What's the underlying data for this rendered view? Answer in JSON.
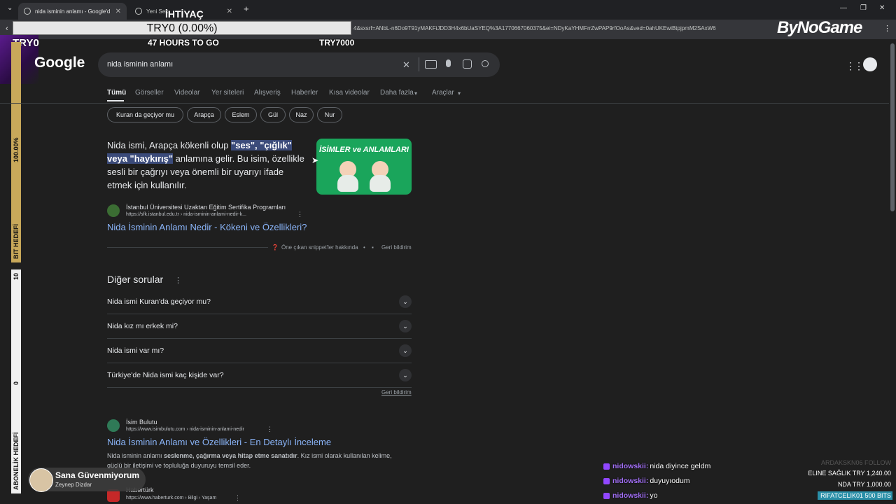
{
  "browser": {
    "tabs": [
      {
        "label": "nida isminin anlamı - Google'd"
      },
      {
        "label": "Yeni Sek"
      }
    ],
    "url": "4&sxsrf=ANbL-n6Do9T91yMAKFiJDD3H4x6bUaSYEQ%3A1770667060375&ei=NDyKaYHMFrrZwPAP9rfOoAs&ved=0ahUKEwiBtpjpmM2SAxW6"
  },
  "overlay": {
    "goal_title": "İHTİYAÇ",
    "goal_value": "TRY0 (0.00%)",
    "left_amount": "TRY0",
    "hours": "47 HOURS TO GO",
    "target": "TRY7000",
    "bar1_pct": "100.00%",
    "bar1_label": "BIT HEDEFİ",
    "bar2_top": "10",
    "bar2_mid": "0",
    "bar2_label": "ABONELİK HEDEFİ",
    "brand": "ByNoGame"
  },
  "google": {
    "logo": "Google",
    "query": "nida isminin anlamı",
    "tabs": [
      "Tümü",
      "Görseller",
      "Videolar",
      "Yer siteleri",
      "Alışveriş",
      "Haberler",
      "Kısa videolar",
      "Daha fazla",
      "Araçlar"
    ],
    "chips": [
      "Kuran da geçiyor mu",
      "Arapça",
      "Eslem",
      "Gül",
      "Naz",
      "Nur"
    ],
    "snippet": {
      "pre": "Nida ismi, Arapça kökenli olup ",
      "highlight": "\"ses\", \"çığlık\" veya \"haykırış\"",
      "post": " anlamına gelir. Bu isim, özellikle sesli bir çağrıyı veya önemli bir uyarıyı ifade etmek için kullanılır.",
      "image_title": "İSİMLER ve ANLAMLARI",
      "source_name": "İstanbul Üniversitesi Uzaktan Eğitim Sertifika Programları",
      "source_url": "https://sfk.istanbul.edu.tr › nida-isminin-anlami-nedir-k...",
      "link": "Nida İsminin Anlamı Nedir - Kökeni ve Özellikleri?",
      "about": "Öne çıkan snippet'ler hakkında",
      "feedback": "Geri bildirim"
    },
    "paa": {
      "title": "Diğer sorular",
      "questions": [
        "Nida ismi Kuran'da geçiyor mu?",
        "Nida kız mı erkek mi?",
        "Nida ismi var mı?",
        "Türkiye'de Nida ismi kaç kişide var?"
      ],
      "feedback": "Geri bildirim"
    },
    "result2": {
      "source_name": "İsim Bulutu",
      "source_url": "https://www.isimbulutu.com › nida-isminin-anlami-nedir",
      "link": "Nida İsminin Anlamı ve Özellikleri - En Detaylı İnceleme",
      "desc_pre": "Nida isminin anlamı ",
      "desc_bold": "seslenme, çağırma veya hitap etme sanatıdır",
      "desc_post": ". Kız ismi olarak kullanılan kelime,",
      "desc_line2": "güçlü bir iletişimi ve topluluğa duyuruyu temsil eder."
    },
    "result3": {
      "source_name": "Habertürk",
      "source_url": "https://www.haberturk.com › Bilgi › Yaşam"
    }
  },
  "music": {
    "title": "Sana Güvenmiyorum",
    "artist": "Zeynep Dizdar"
  },
  "chat": [
    {
      "user": "nidowskii:",
      "msg": "nida diyince geldm"
    },
    {
      "user": "nidowskii:",
      "msg": "duyuyıodum"
    },
    {
      "user": "nidowskii:",
      "msg": "yo"
    }
  ],
  "donations": {
    "follow": "ARDAKSKN06  FOLLOW",
    "line1": "ELINE SAĞLIK   TRY 1,240.00",
    "line2": "NDA   TRY 1,000.00",
    "line3": "RIFATCELIK01   500 BITS"
  }
}
